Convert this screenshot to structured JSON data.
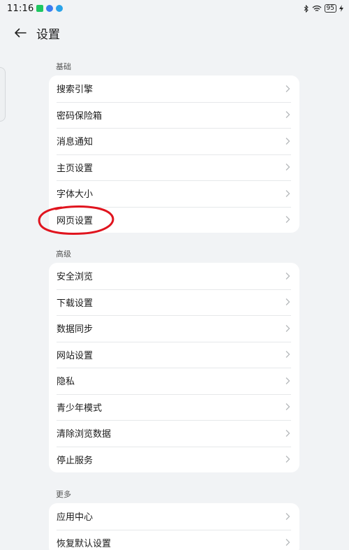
{
  "status_bar": {
    "time": "11:16",
    "battery": "95"
  },
  "header": {
    "title": "设置"
  },
  "sections": [
    {
      "label": "基础",
      "items": [
        "搜索引擎",
        "密码保险箱",
        "消息通知",
        "主页设置",
        "字体大小",
        "网页设置"
      ]
    },
    {
      "label": "高级",
      "items": [
        "安全浏览",
        "下载设置",
        "数据同步",
        "网站设置",
        "隐私",
        "青少年模式",
        "清除浏览数据",
        "停止服务"
      ]
    },
    {
      "label": "更多",
      "items": [
        "应用中心",
        "恢复默认设置"
      ]
    }
  ],
  "icons": {
    "back": "arrow-left-icon",
    "chevron": "chevron-right-icon",
    "bluetooth": "bluetooth-icon",
    "wifi": "wifi-icon"
  },
  "colors": {
    "background": "#f1f3f5",
    "card": "#ffffff",
    "annotation": "#e0141e"
  }
}
